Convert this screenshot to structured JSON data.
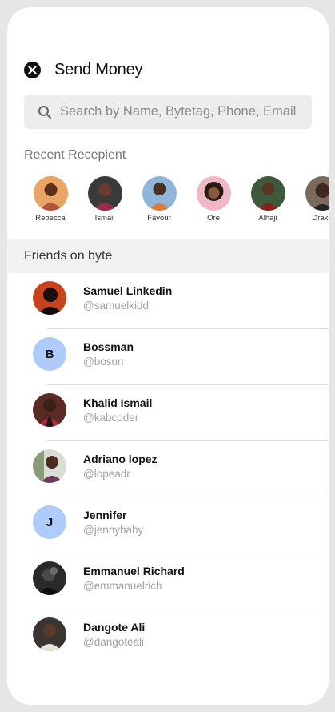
{
  "header": {
    "title": "Send Money"
  },
  "search": {
    "placeholder": "Search by Name, Bytetag, Phone, Email"
  },
  "recent": {
    "label": "Recent Recepient",
    "items": [
      {
        "name": "Rebecca"
      },
      {
        "name": "Ismail"
      },
      {
        "name": "Favour"
      },
      {
        "name": "Ore"
      },
      {
        "name": "Alhaji"
      },
      {
        "name": "Drake"
      }
    ]
  },
  "friends": {
    "label": "Friends on byte",
    "items": [
      {
        "name": "Samuel Linkedin",
        "handle": "@samuelkidd",
        "initial": ""
      },
      {
        "name": "Bossman",
        "handle": "@bosun",
        "initial": "B"
      },
      {
        "name": "Khalid Ismail",
        "handle": "@kabcoder",
        "initial": ""
      },
      {
        "name": "Adriano lopez",
        "handle": "@lopeadr",
        "initial": ""
      },
      {
        "name": "Jennifer",
        "handle": "@jennybaby",
        "initial": "J"
      },
      {
        "name": "Emmanuel Richard",
        "handle": "@emmanuelrich",
        "initial": ""
      },
      {
        "name": "Dangote Ali",
        "handle": "@dangoteali",
        "initial": ""
      }
    ]
  },
  "colors": {
    "initial_avatar_bg": "#aecbfa",
    "search_bg": "#ededed",
    "section_bg": "#f2f2f2"
  }
}
